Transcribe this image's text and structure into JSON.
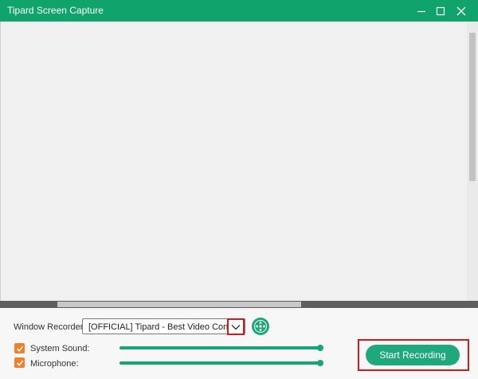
{
  "window": {
    "title": "Tipard Screen Capture",
    "accent_color": "#10a36b",
    "controls": {
      "minimize_icon": "minimize-icon",
      "maximize_icon": "maximize-icon",
      "close_icon": "close-icon"
    }
  },
  "recorder": {
    "label": "Window Recorder:",
    "selected_window": "[OFFICIAL] Tipard - Best Video Converter",
    "dropdown_icon": "chevron-down-icon",
    "picker_icon": "window-picker-icon"
  },
  "audio": {
    "system_sound": {
      "label": "System Sound:",
      "checked": true,
      "volume": 1.0
    },
    "microphone": {
      "label": "Microphone:",
      "checked": true,
      "volume": 1.0
    },
    "checkbox_color": "#f07f2a",
    "slider_color": "#17a577"
  },
  "actions": {
    "start_recording": "Start Recording",
    "highlight_color": "#d11a1a"
  }
}
